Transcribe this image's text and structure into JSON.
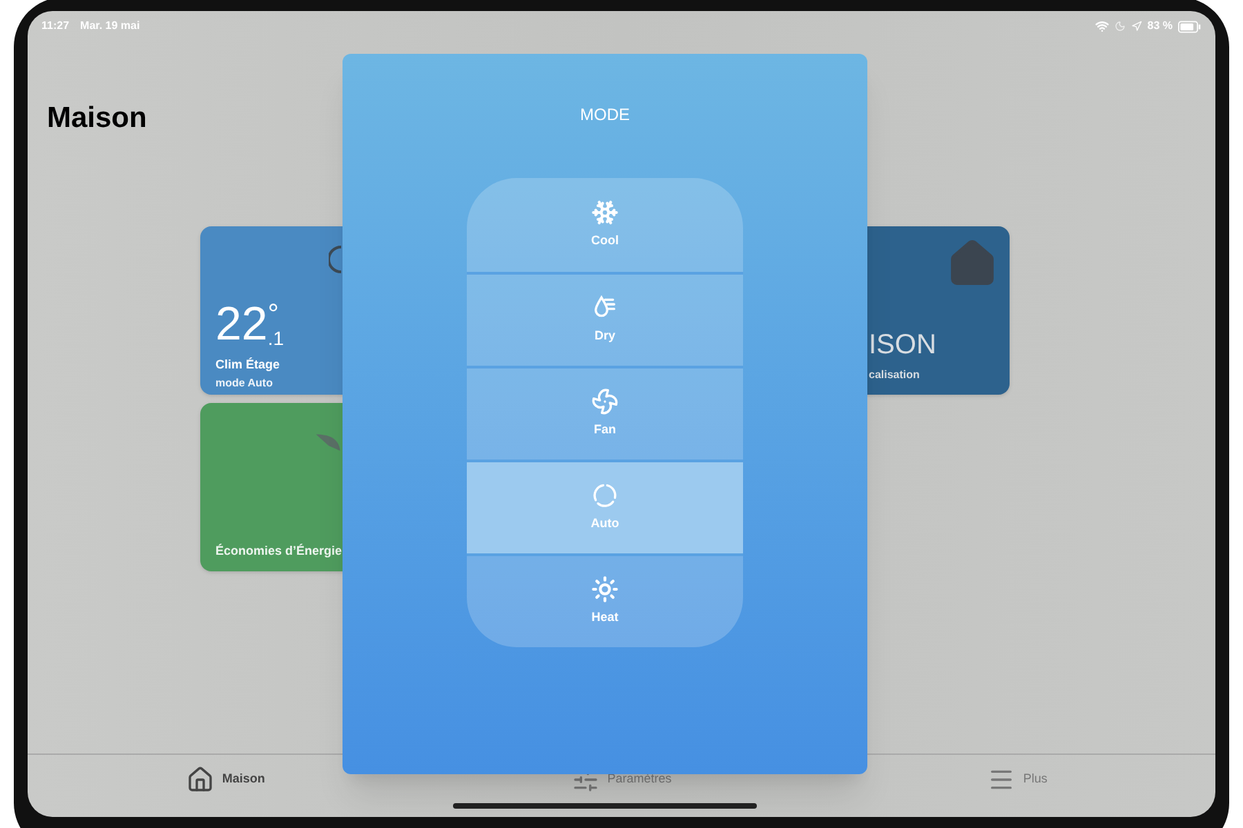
{
  "status_bar": {
    "time": "11:27",
    "date": "Mar. 19 mai",
    "battery": "83 %"
  },
  "page": {
    "title": "Maison"
  },
  "cards": [
    {
      "kind": "climate",
      "temperature": "22",
      "unit": "°",
      "decimal": ".1",
      "name": "Clim Étage",
      "subtitle": "mode Auto"
    },
    {
      "kind": "energy",
      "name": "Économies d’Énergie"
    },
    {
      "kind": "home",
      "name": "ISON",
      "subtitle": "calisation"
    }
  ],
  "modal": {
    "title": "MODE",
    "modes": [
      {
        "kind": "cool",
        "label": "Cool",
        "selected": false
      },
      {
        "kind": "dry",
        "label": "Dry",
        "selected": false
      },
      {
        "kind": "fan",
        "label": "Fan",
        "selected": false
      },
      {
        "kind": "auto",
        "label": "Auto",
        "selected": true
      },
      {
        "kind": "heat",
        "label": "Heat",
        "selected": false
      }
    ]
  },
  "tab_bar": {
    "items": [
      {
        "kind": "home",
        "label": "Maison",
        "selected": true
      },
      {
        "kind": "settings",
        "label": "Paramètres",
        "selected": false
      },
      {
        "kind": "more",
        "label": "Plus",
        "selected": false
      }
    ]
  }
}
